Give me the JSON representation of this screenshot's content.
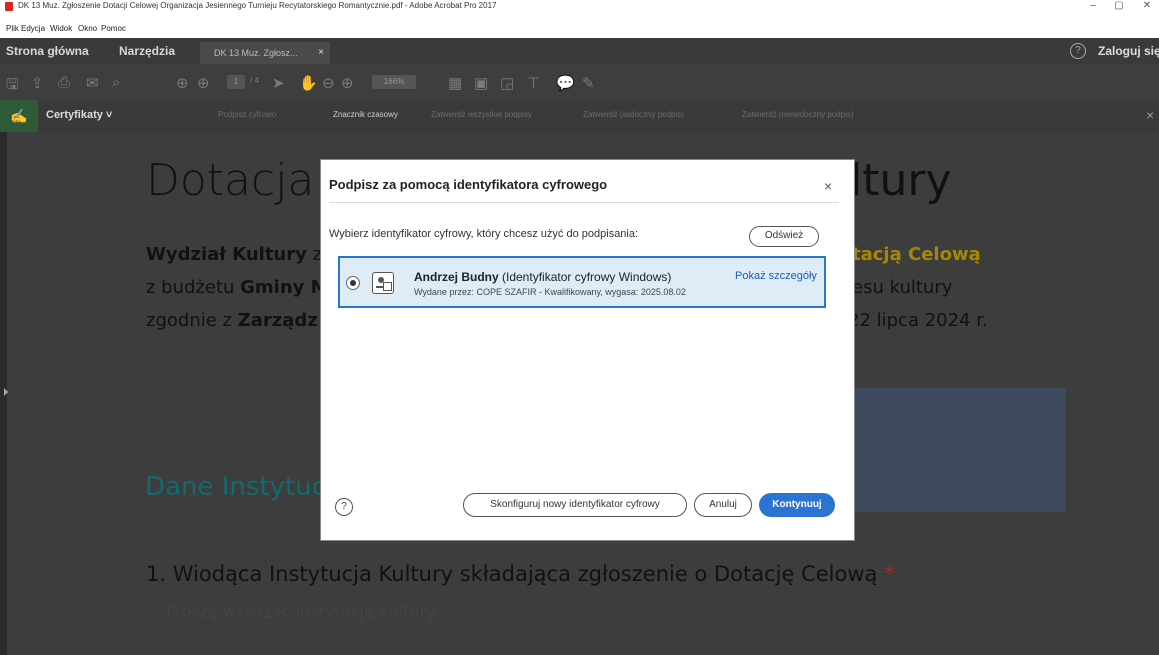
{
  "window": {
    "title": "DK 13 Muz. Zgłoszenie Dotacji Celowej Organizacja Jesiennego Turnieju Recytatorskiego Romantycznie.pdf - Adobe Acrobat Pro 2017",
    "minimize": "–",
    "restore": "▢",
    "close": "✕"
  },
  "menu": {
    "items": [
      "Plik",
      "Edycja",
      "Widok",
      "Okno",
      "Pomoc"
    ]
  },
  "tabs": {
    "home": "Strona główna",
    "tools": "Narzędzia",
    "document": "DK 13 Muz. Zgłosz...",
    "close": "×",
    "help": "?",
    "login": "Zaloguj się"
  },
  "toolbar": {
    "page_current": "1",
    "page_total": "/ 4",
    "zoom": "166%"
  },
  "certbar": {
    "label": "Certyfikaty ˅",
    "actions": [
      "Podpisz cyfrowo",
      "Znacznik czasowy",
      "Zatwierdź wszystkie podpisy",
      "Zatwierdź (widoczny podpis)",
      "Zatwierdź (niewidoczny podpis)"
    ],
    "close": "×"
  },
  "document": {
    "title_left": "Dotacja",
    "title_right": "ltury",
    "para1_left": "Wydział Kultury",
    "para1_left_tail": " z",
    "para1_right": "tacją Celową",
    "para2_left_a": "z budżetu ",
    "para2_left_b": "Gminy M",
    "para2_right": "esu kultury",
    "para3_left_a": "zgodnie z ",
    "para3_left_b": "Zarządz",
    "para3_right": "22 lipca 2024 r.",
    "section_heading": "Dane Instytuc",
    "question": "1. Wiodąca Instytucja Kultury składająca zgłoszenie o Dotację Celową",
    "asterisk": "*",
    "question_hint": "Proszę wskazać Instytucję Kultury."
  },
  "dialog": {
    "title": "Podpisz za pomocą identyfikatora cyfrowego",
    "close": "×",
    "prompt": "Wybierz identyfikator cyfrowy, który chcesz użyć do podpisania:",
    "refresh": "Odśwież",
    "cert": {
      "name": "Andrzej Budny",
      "type": " (Identyfikator cyfrowy Windows)",
      "issuer": "Wydane przez: COPE SZAFIR - Kwalifikowany, wygasa: 2025.08.02",
      "details_link": "Pokaż szczegóły"
    },
    "help": "?",
    "configure": "Skonfiguruj nowy identyfikator cyfrowy",
    "cancel": "Anuluj",
    "continue": "Kontynuuj"
  }
}
